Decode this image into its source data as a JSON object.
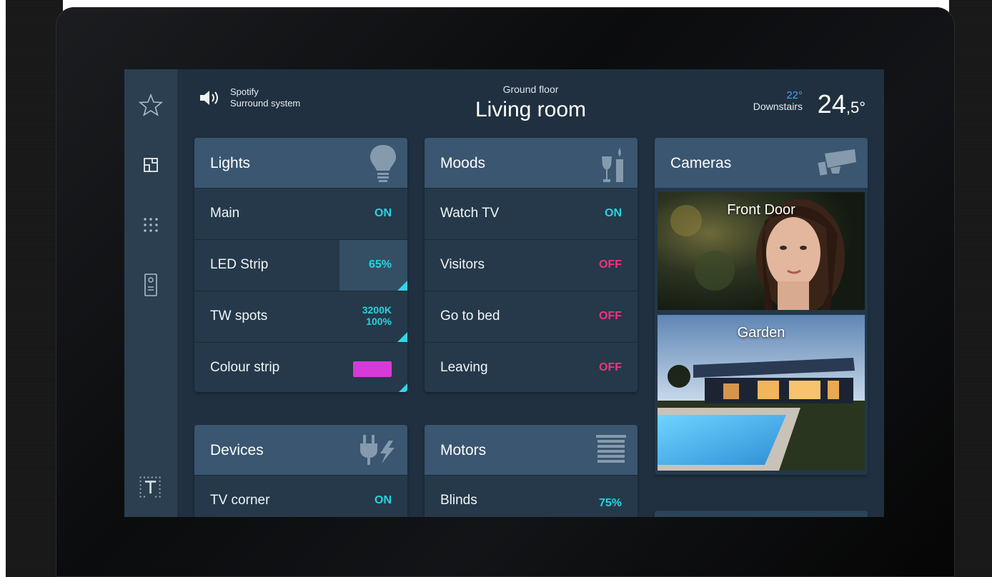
{
  "header": {
    "audio_source": "Spotify",
    "audio_zone": "Surround system",
    "floor": "Ground floor",
    "room": "Living room",
    "temp_setpoint": "22°",
    "temp_zone": "Downstairs",
    "temp_main": "24",
    "temp_decimal": ",5°"
  },
  "sidebar": {
    "items": [
      "favorites-star-icon",
      "floorplan-icon",
      "apps-grid-icon",
      "intercom-icon",
      "brand-logo-icon"
    ]
  },
  "lights": {
    "title": "Lights",
    "rows": [
      {
        "label": "Main",
        "value": "ON"
      },
      {
        "label": "LED Strip",
        "value": "65%",
        "level": 0.65
      },
      {
        "label": "TW spots",
        "value_line1": "3200K",
        "value_line2": "100%"
      },
      {
        "label": "Colour strip",
        "swatch": "#d63ad8"
      }
    ]
  },
  "moods": {
    "title": "Moods",
    "rows": [
      {
        "label": "Watch TV",
        "value": "ON"
      },
      {
        "label": "Visitors",
        "value": "OFF"
      },
      {
        "label": "Go to bed",
        "value": "OFF"
      },
      {
        "label": "Leaving",
        "value": "OFF"
      }
    ]
  },
  "devices": {
    "title": "Devices",
    "rows": [
      {
        "label": "TV corner",
        "value": "ON"
      }
    ]
  },
  "motors": {
    "title": "Motors",
    "rows": [
      {
        "label": "Blinds",
        "value": "75%"
      }
    ]
  },
  "cameras": {
    "title": "Cameras",
    "feeds": [
      {
        "label": "Front Door"
      },
      {
        "label": "Garden"
      }
    ]
  },
  "colors": {
    "on": "#27d3e0",
    "off": "#ff2e7e",
    "accent": "#3fa6ee",
    "card_header": "#3a5670"
  }
}
